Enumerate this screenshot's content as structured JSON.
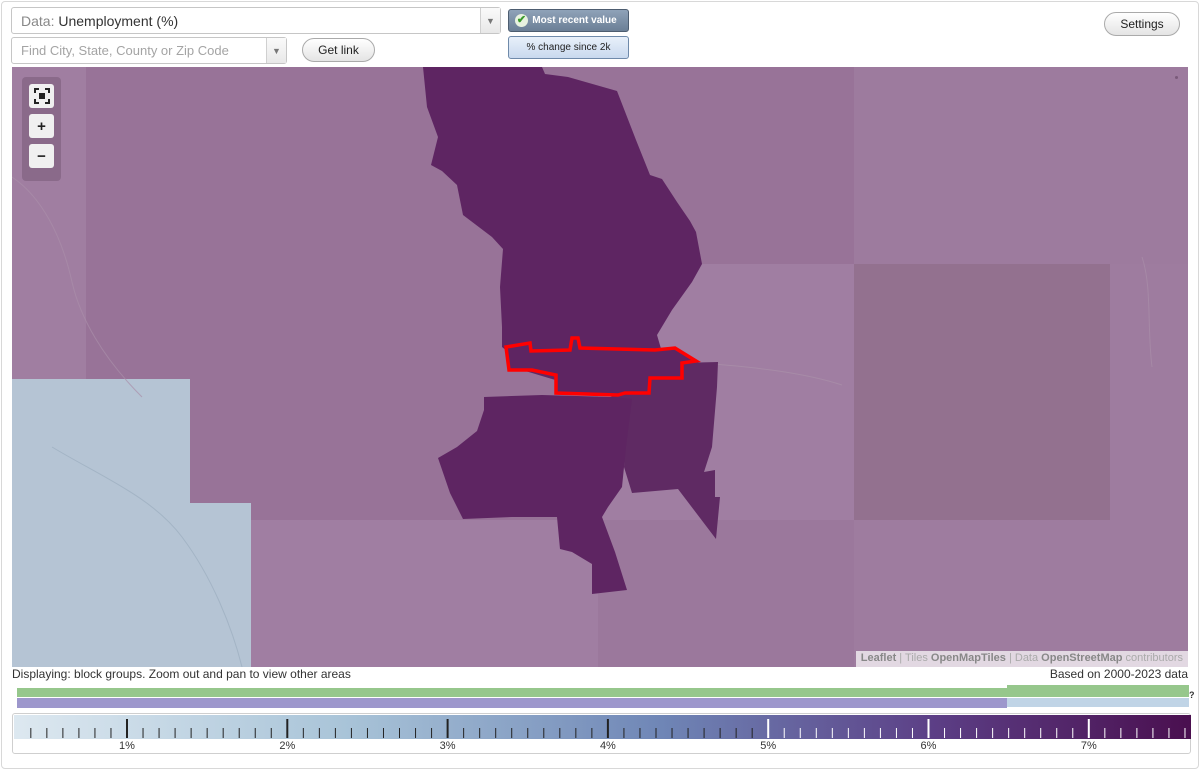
{
  "header": {
    "data_prefix": "Data:",
    "data_value": "Unemployment (%)",
    "search_placeholder": "Find City, State, County or Zip Code",
    "get_link_label": "Get link",
    "settings_label": "Settings",
    "toggle_recent_label": "Most recent value",
    "toggle_change_label": "% change since 2k",
    "toggle_selected": "Most recent value"
  },
  "icons": {
    "data_dropdown": "chevron-down-icon",
    "search_dropdown": "chevron-down-icon",
    "recent_check": "check-icon",
    "fit_bounds": "fit-bounds-icon",
    "zoom_in": "plus-icon",
    "zoom_out": "minus-icon"
  },
  "map": {
    "attribution": {
      "leaflet": "Leaflet",
      "sep1": " | ",
      "tiles_prefix": "Tiles ",
      "tiles_source": "OpenMapTiles",
      "sep2": " | ",
      "data_prefix": "Data ",
      "data_source": "OpenStreetMap",
      "contributors": " contributors"
    },
    "colors": {
      "highlight_outline": "#ff0000",
      "dark_area": "#5e2562",
      "medium_area": "#9b7a9d",
      "low_area": "#b4c3d4"
    }
  },
  "footer": {
    "display_text": "Displaying: block groups. Zoom out and pan to view other areas",
    "based_text": "Based on 2000-2023 data",
    "help_mark": "?"
  },
  "legend": {
    "ticks": [
      "1%",
      "2%",
      "3%",
      "4%",
      "5%",
      "6%",
      "7%"
    ],
    "gradient_start": "#dde8f0",
    "gradient_end": "#4a0f4f",
    "green_bar_color": "#96c78c",
    "purple_bar_color": "#9d97cc"
  }
}
